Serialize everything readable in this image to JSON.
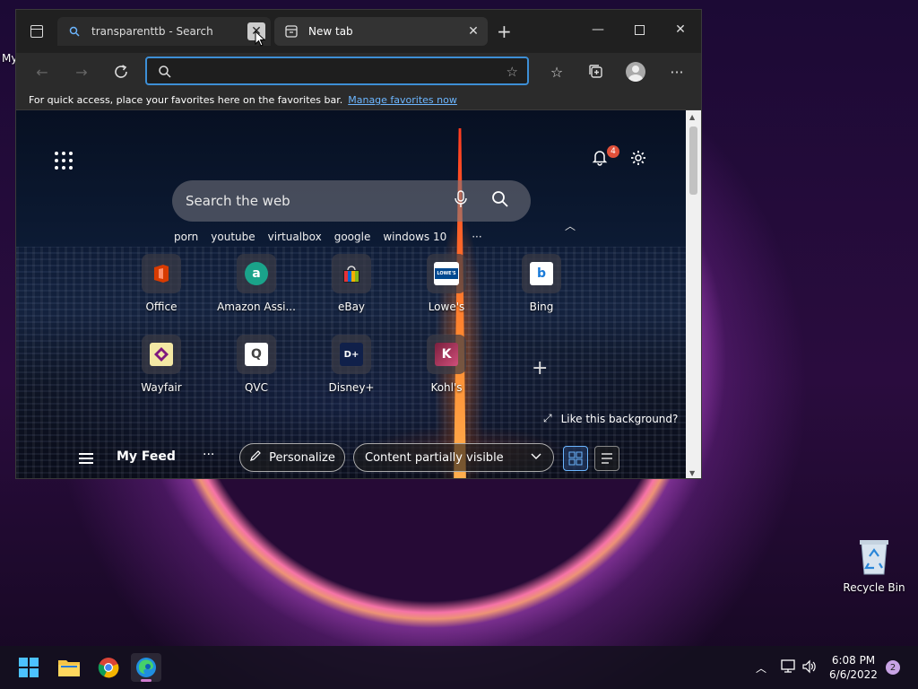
{
  "desktop": {
    "cut_label": "My",
    "icons": [
      {
        "label": "Recycle Bin",
        "icon": "recycle-bin-icon"
      }
    ]
  },
  "browser": {
    "tabs": [
      {
        "label": "transparenttb - Search",
        "icon": "search-icon",
        "active": false
      },
      {
        "label": "New tab",
        "icon": "new-tab-icon",
        "active": true
      }
    ],
    "address": {
      "value": "",
      "placeholder": ""
    },
    "favorites_bar": {
      "text": "For quick access, place your favorites here on the favorites bar.",
      "link": "Manage favorites now"
    }
  },
  "newtab": {
    "notifications_count": "4",
    "search_placeholder": "Search the web",
    "quick_links": [
      "porn",
      "youtube",
      "virtualbox",
      "google",
      "windows 10"
    ],
    "quick_more": "···",
    "tiles": [
      {
        "name": "Office",
        "logo": "office-logo-icon",
        "color": "#d83b01",
        "glyph": ""
      },
      {
        "name": "Amazon Assi...",
        "logo": "amazon-assistant-logo-icon",
        "color": "#1aa38a",
        "glyph": "a"
      },
      {
        "name": "eBay",
        "logo": "ebay-logo-icon",
        "color": "#444444",
        "glyph": ""
      },
      {
        "name": "Lowe's",
        "logo": "lowes-logo-icon",
        "color": "#ffffff",
        "glyph": "LOWE'S"
      },
      {
        "name": "Bing",
        "logo": "bing-logo-icon",
        "color": "#ffffff",
        "glyph": "b"
      },
      {
        "name": "Wayfair",
        "logo": "wayfair-logo-icon",
        "color": "#f3e8a4",
        "glyph": ""
      },
      {
        "name": "QVC",
        "logo": "qvc-logo-icon",
        "color": "#ffffff",
        "glyph": "Q"
      },
      {
        "name": "Disney+",
        "logo": "disney-plus-logo-icon",
        "color": "#10204a",
        "glyph": "D+"
      },
      {
        "name": "Kohl's",
        "logo": "kohls-logo-icon",
        "color": "#7a1f3d",
        "glyph": "K"
      }
    ],
    "like_background": "Like this background?",
    "feed": {
      "title": "My Feed",
      "more": "···",
      "personalize": "Personalize",
      "visibility": "Content partially visible"
    }
  },
  "taskbar": {
    "apps": [
      "start-icon",
      "file-explorer-icon",
      "chrome-icon",
      "edge-icon"
    ],
    "time": "6:08 PM",
    "date": "6/6/2022",
    "notification_count": "2"
  },
  "colors": {
    "accent": "#3d8fd6",
    "link": "#6cb6ff",
    "badge": "#e0503a"
  }
}
